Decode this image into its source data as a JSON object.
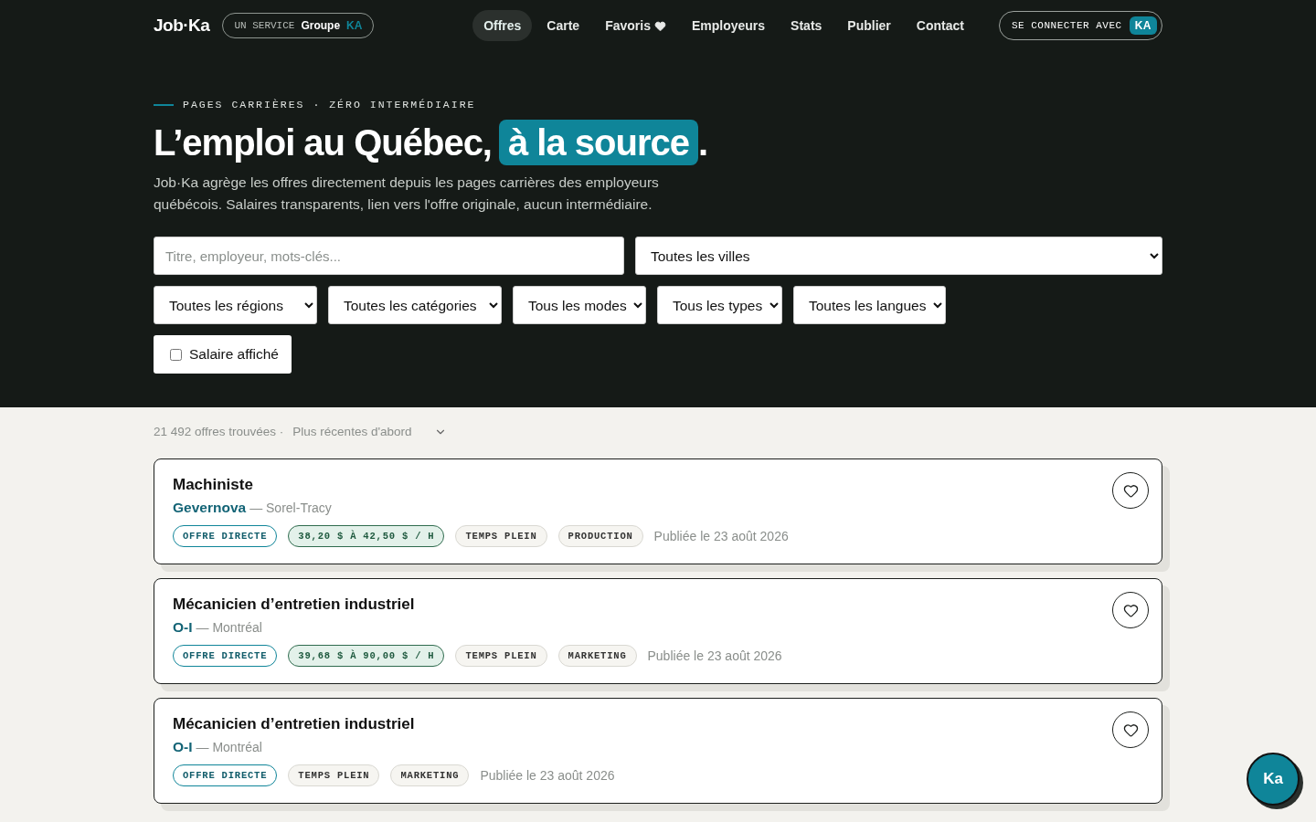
{
  "header": {
    "logo": "Job·Ka",
    "badge": {
      "prefix": "UN SERVICE",
      "group": "Groupe",
      "brand": "KA"
    },
    "nav": [
      {
        "label": "Offres",
        "selected": true
      },
      {
        "label": "Carte",
        "selected": false
      },
      {
        "label": "Favoris",
        "selected": false
      },
      {
        "label": "Employeurs",
        "selected": false
      },
      {
        "label": "Stats",
        "selected": false
      },
      {
        "label": "Publier",
        "selected": false
      },
      {
        "label": "Contact",
        "selected": false
      }
    ],
    "login": {
      "label": "SE CONNECTER AVEC",
      "brand": "KA"
    }
  },
  "hero": {
    "eyebrow": "PAGES CARRIÈRES · ZÉRO INTERMÉDIAIRE",
    "title": "L’emploi au Québec,",
    "highlight": "à la source",
    "title_end": ".",
    "intro": "Job·Ka agrège les offres directement depuis les pages carrières des employeurs québécois. Salaires transparents, lien vers l'offre originale, aucun intermédiaire."
  },
  "filters": {
    "search": {
      "placeholder": "Titre, employeur, mots-clés..."
    },
    "city": "Toutes les villes",
    "selects": [
      "Toutes les régions",
      "Toutes les catégories",
      "Tous les modes",
      "Tous les types",
      "Toutes les langues"
    ],
    "salary": {
      "label": "Salaire affiché",
      "checked": false
    }
  },
  "results": {
    "count": "21 492 offres trouvées ·",
    "sort": "Plus récentes d'abord"
  },
  "jobs": [
    {
      "title": "Machiniste",
      "employer": "Gevernova",
      "city": "— Sorel-Tracy",
      "favorite": false,
      "date": "Publiée le 23 août 2026",
      "tags": [
        {
          "label": "OFFRE DIRECTE",
          "kind": "direct"
        },
        {
          "label": "38,20 $ À 42,50 $ / H",
          "kind": "salary"
        },
        {
          "label": "TEMPS PLEIN",
          "kind": "plain"
        },
        {
          "label": "PRODUCTION",
          "kind": "plain"
        }
      ]
    },
    {
      "title": "Mécanicien d’entretien industriel",
      "employer": "O-I",
      "city": "— Montréal",
      "favorite": false,
      "date": "Publiée le 23 août 2026",
      "tags": [
        {
          "label": "OFFRE DIRECTE",
          "kind": "direct"
        },
        {
          "label": "39,68 $ À 90,00 $ / H",
          "kind": "salary"
        },
        {
          "label": "TEMPS PLEIN",
          "kind": "plain"
        },
        {
          "label": "MARKETING",
          "kind": "plain"
        }
      ]
    },
    {
      "title": "Mécanicien d’entretien industriel",
      "employer": "O-I",
      "city": "— Montréal",
      "favorite": false,
      "date": "Publiée le 23 août 2026",
      "tags": [
        {
          "label": "OFFRE DIRECTE",
          "kind": "direct"
        },
        {
          "label": "TEMPS PLEIN",
          "kind": "plain"
        },
        {
          "label": "MARKETING",
          "kind": "plain"
        }
      ]
    }
  ],
  "assistant": {
    "label": "Ka"
  }
}
